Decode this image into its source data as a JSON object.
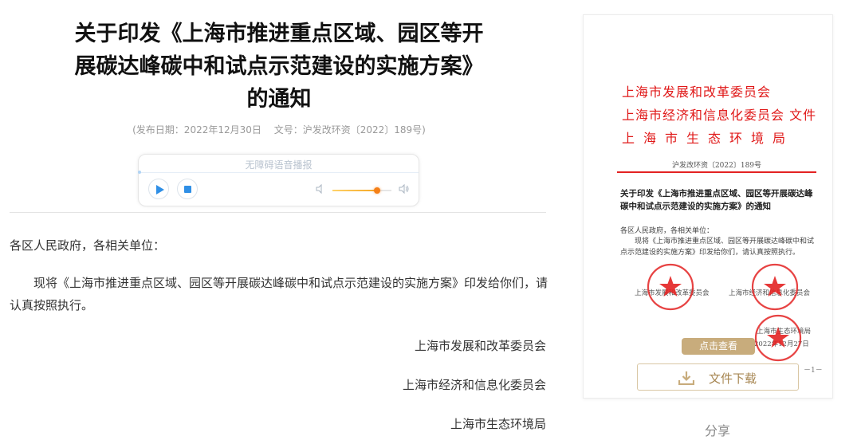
{
  "article": {
    "title_lines": [
      "关于印发《上海市推进重点区域、园区等开",
      "展碳达峰碳中和试点示范建设的实施方案》",
      "的通知"
    ],
    "publish_date": "(发布日期：2022年12月30日",
    "doc_number": "文号：沪发改环资〔2022〕189号)",
    "salutation": "各区人民政府，各相关单位：",
    "paragraph": "现将《上海市推进重点区域、园区等开展碳达峰碳中和试点示范建设的实施方案》印发给你们，请认真按照执行。",
    "signatories": [
      "上海市发展和改革委员会",
      "上海市经济和信息化委员会",
      "上海市生态环境局"
    ]
  },
  "player": {
    "title": "无障碍语音播报",
    "volume": 0.76,
    "play_icon": "play-icon",
    "stop_icon": "stop-icon"
  },
  "preview": {
    "issuers": [
      "上海市发展和改革委员会",
      "上海市经济和信息化委员会 文件",
      "上海市生态环境局"
    ],
    "doc_number": "沪发改环资〔2022〕189号",
    "title": "关于印发《上海市推进重点区域、园区等开展碳达峰碳中和试点示范建设的实施方案》的通知",
    "salutation": "各区人民政府，各相关单位：",
    "paragraph": "现将《上海市推进重点区域、园区等开展碳达峰碳中和试点示范建设的实施方案》印发给你们，请认真按照执行。",
    "sig_a": "上海市发展和改革委员会",
    "sig_b": "上海市经济和信息化委员会",
    "sig_c": "上海市生态环境局",
    "date": "2022年12月27日",
    "page_no": "－1－",
    "view_button": "点击查看",
    "download_button": "文件下载",
    "download_icon": "download-icon",
    "seal_color": "#e32222"
  },
  "share_label": "分享",
  "colors": {
    "accent_blue": "#2f8fe6",
    "issuer_red": "#e01818",
    "gold": "#c8ac7c",
    "volume_knob": "#f57f17"
  }
}
